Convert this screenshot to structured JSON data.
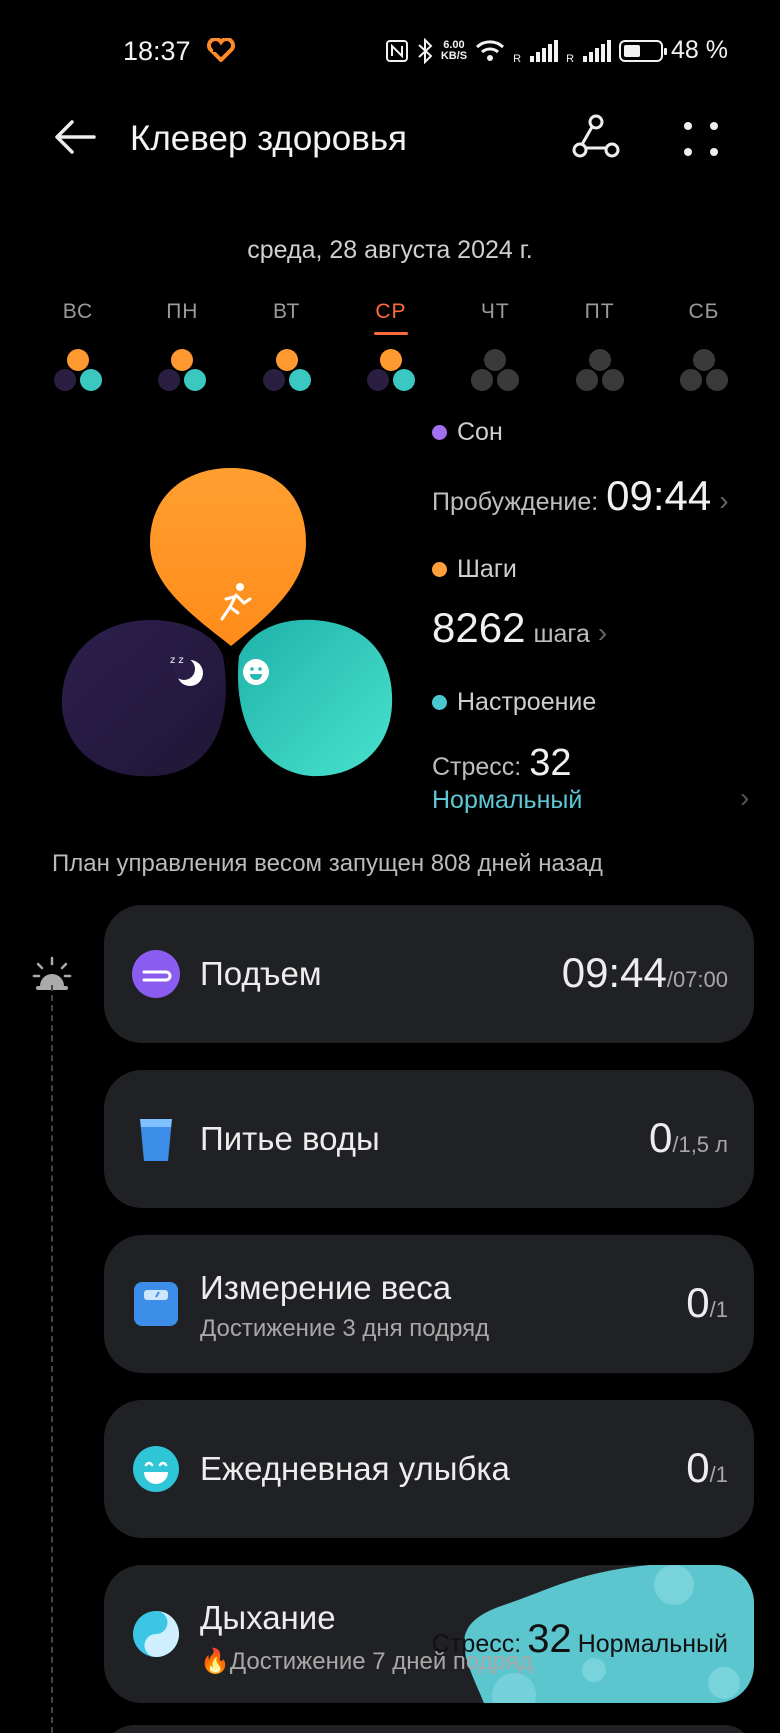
{
  "status_bar": {
    "time": "18:37",
    "speed_value": "6.00",
    "speed_unit": "KB/S",
    "battery": "48 %"
  },
  "header": {
    "title": "Клевер здоровья"
  },
  "date": "среда, 28 августа 2024 г.",
  "week": [
    {
      "label": "ВС",
      "active": false,
      "filled": true
    },
    {
      "label": "ПН",
      "active": false,
      "filled": true
    },
    {
      "label": "ВТ",
      "active": false,
      "filled": true
    },
    {
      "label": "СР",
      "active": true,
      "filled": true
    },
    {
      "label": "ЧТ",
      "active": false,
      "filled": false
    },
    {
      "label": "ПТ",
      "active": false,
      "filled": false
    },
    {
      "label": "СБ",
      "active": false,
      "filled": false
    }
  ],
  "metrics": {
    "sleep_label": "Сон",
    "wake_label": "Пробуждение:",
    "wake_value": "09:44",
    "steps_label": "Шаги",
    "steps_value": "8262",
    "steps_unit": "шага",
    "mood_label": "Настроение",
    "stress_label": "Стресс:",
    "stress_value": "32",
    "stress_state": "Нормальный"
  },
  "plan_text": "План управления весом запущен 808 дней назад",
  "cards": [
    {
      "title": "Подъем",
      "value": "09:44",
      "target": "/07:00"
    },
    {
      "title": "Питье воды",
      "value": "0",
      "target": "/1,5 л"
    },
    {
      "title": "Измерение веса",
      "subtitle": "Достижение 3 дня подряд",
      "value": "0",
      "target": "/1"
    },
    {
      "title": "Ежедневная улыбка",
      "value": "0",
      "target": "/1"
    },
    {
      "title": "Дыхание",
      "subtitle": "Достижение 7 дней подряд",
      "stress_label": "Стресс:",
      "stress_value": "32",
      "stress_state": "Нормальный"
    }
  ],
  "colors": {
    "accent": "#ff6a3c",
    "sleep": "#a070f0",
    "steps": "#ffa03c",
    "mood": "#4ac8d0"
  }
}
